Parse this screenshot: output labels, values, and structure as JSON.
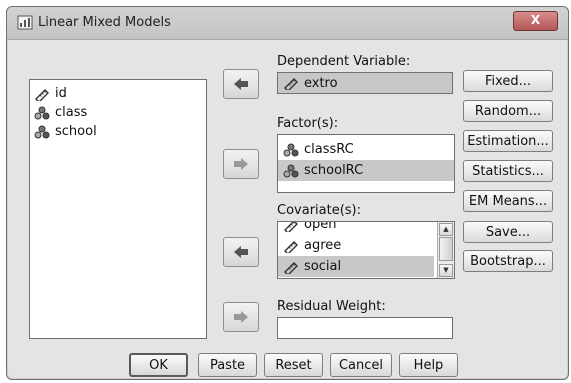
{
  "window": {
    "title": "Linear Mixed Models",
    "close_label": "X"
  },
  "source_list": {
    "items": [
      {
        "label": "id",
        "icon": "scale-ruler-icon"
      },
      {
        "label": "class",
        "icon": "nominal-variable-icon"
      },
      {
        "label": "school",
        "icon": "nominal-variable-icon"
      }
    ]
  },
  "dependent": {
    "label": "Dependent Variable:",
    "value": "extro",
    "icon": "scale-ruler-icon"
  },
  "factors": {
    "label": "Factor(s):",
    "items": [
      {
        "label": "classRC",
        "icon": "nominal-variable-icon",
        "selected": false
      },
      {
        "label": "schoolRC",
        "icon": "nominal-variable-icon",
        "selected": true
      }
    ]
  },
  "covariates": {
    "label": "Covariate(s):",
    "items": [
      {
        "label": "open",
        "icon": "scale-ruler-icon",
        "selected": false
      },
      {
        "label": "agree",
        "icon": "scale-ruler-icon",
        "selected": false
      },
      {
        "label": "social",
        "icon": "scale-ruler-icon",
        "selected": true
      }
    ]
  },
  "residual_weight": {
    "label": "Residual Weight:",
    "value": ""
  },
  "side_buttons": {
    "fixed": "Fixed...",
    "random": "Random...",
    "estimation": "Estimation...",
    "statistics": "Statistics...",
    "em_means": "EM Means...",
    "save": "Save...",
    "bootstrap": "Bootstrap..."
  },
  "bottom_buttons": {
    "ok": "OK",
    "paste": "Paste",
    "reset": "Reset",
    "cancel": "Cancel",
    "help": "Help"
  },
  "colors": {
    "selection": "#c8c8c8",
    "dialog_bg": "#e4e4e4",
    "close_button": "#b45555"
  }
}
